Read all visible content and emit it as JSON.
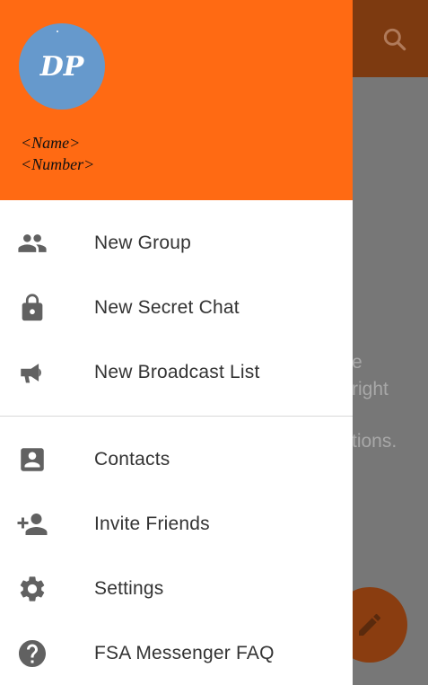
{
  "background": {
    "text_lines": [
      "e",
      "right",
      "tions."
    ],
    "search_icon": "search-icon",
    "fab_icon": "pencil-icon"
  },
  "drawer": {
    "avatar_initials": "DP",
    "user_name": "<Name>",
    "user_number": "<Number>",
    "items": [
      {
        "label": "New Group",
        "icon": "group-icon"
      },
      {
        "label": "New Secret Chat",
        "icon": "lock-icon"
      },
      {
        "label": "New Broadcast List",
        "icon": "megaphone-icon"
      },
      {
        "label": "Contacts",
        "icon": "contact-icon"
      },
      {
        "label": "Invite Friends",
        "icon": "add-person-icon"
      },
      {
        "label": "Settings",
        "icon": "gear-icon"
      },
      {
        "label": "FSA Messenger FAQ",
        "icon": "help-icon"
      }
    ]
  },
  "colors": {
    "header": "#ff6a13",
    "avatar": "#6699cc",
    "icon": "#616161",
    "label": "#333333"
  }
}
